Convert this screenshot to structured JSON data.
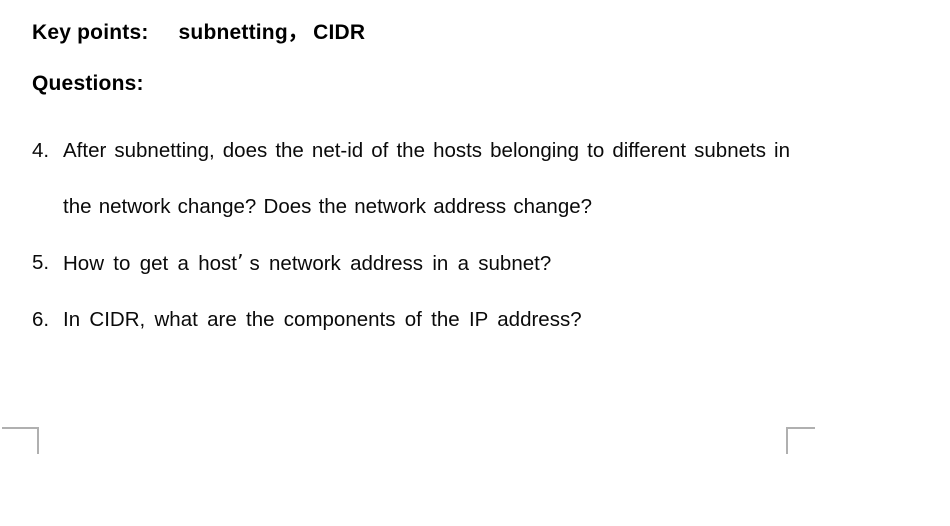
{
  "slide": {
    "background_color": "#ffffff",
    "text_color": "#000000",
    "corner_mark_color": "#b0b0b0"
  },
  "key_points": {
    "label": "Key points:",
    "value": "subnetting",
    "separator": "，",
    "value2": "CIDR"
  },
  "questions_heading": "Questions:",
  "questions": [
    {
      "number": "4.",
      "text_before_break": "After subnetting, does the net-id of the hosts belonging to different subnets in the network change? Does the network address change?",
      "lines": [
        "After subnetting, does the net-id of the hosts belonging to",
        "different subnets in the network change? Does the network",
        "address change?"
      ]
    },
    {
      "number": "5.",
      "text": "How to get a host' s network address in a subnet?",
      "part_a": "How to get a host",
      "apostrophe": "’",
      "part_b": "s network address in a subnet?"
    },
    {
      "number": "6.",
      "text": "In CIDR, what are the components of the IP address?"
    }
  ],
  "corner_marks": {
    "left": "crop-mark-bottom-left",
    "right": "crop-mark-bottom-right"
  }
}
